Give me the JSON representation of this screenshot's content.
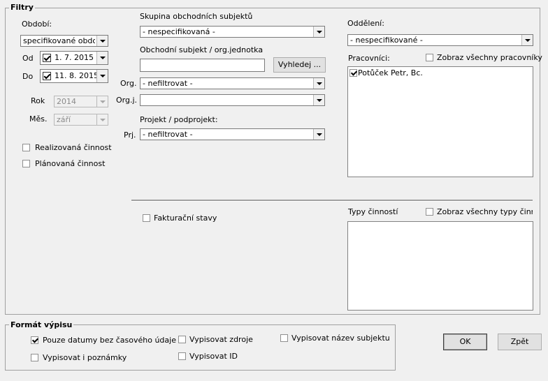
{
  "filters": {
    "title": "Filtry",
    "period": {
      "label": "Období:",
      "selected": "specifikované období",
      "from_label": "Od",
      "from_value": "1. 7. 2015",
      "to_label": "Do",
      "to_value": "11. 8. 2015",
      "year_label": "Rok",
      "year_value": "2014",
      "month_label": "Měs.",
      "month_value": "září"
    },
    "realized_label": "Realizovaná činnost",
    "planned_label": "Plánovaná činnost",
    "subject_group": {
      "label": "Skupina obchodních subjektů",
      "selected": "- nespecifikovaná -"
    },
    "business_subject": {
      "label": "Obchodní subjekt / org.jednotka",
      "value": "",
      "search_button": "Vyhledej ..."
    },
    "org": {
      "label": "Org.",
      "selected": "-  nefiltrovat  -"
    },
    "orgj": {
      "label": "Org.j.",
      "selected": ""
    },
    "project": {
      "label": "Projekt / podprojekt:",
      "prj_label": "Prj.",
      "selected": "-  nefiltrovat  -"
    },
    "department": {
      "label": "Oddělení:",
      "selected": "- nespecifikované -"
    },
    "workers": {
      "label": "Pracovníci:",
      "show_all_label": "Zobraz všechny pracovníky",
      "items": [
        {
          "label": "Potůček Petr, Bc.",
          "checked": true
        }
      ]
    },
    "billing_states_label": "Fakturační stavy",
    "activity_types": {
      "label": "Typy činností",
      "show_all_label": "Zobraz všechny typy činnost"
    }
  },
  "format": {
    "title": "Formát výpisu",
    "dates_only_label": "Pouze datumy bez časového údaje",
    "notes_label": "Vypisovat i poznámky",
    "sources_label": "Vypisovat zdroje",
    "id_label": "Vypisovat ID",
    "subject_name_label": "Vypisovat název subjektu"
  },
  "buttons": {
    "ok": "OK",
    "back": "Zpět"
  }
}
